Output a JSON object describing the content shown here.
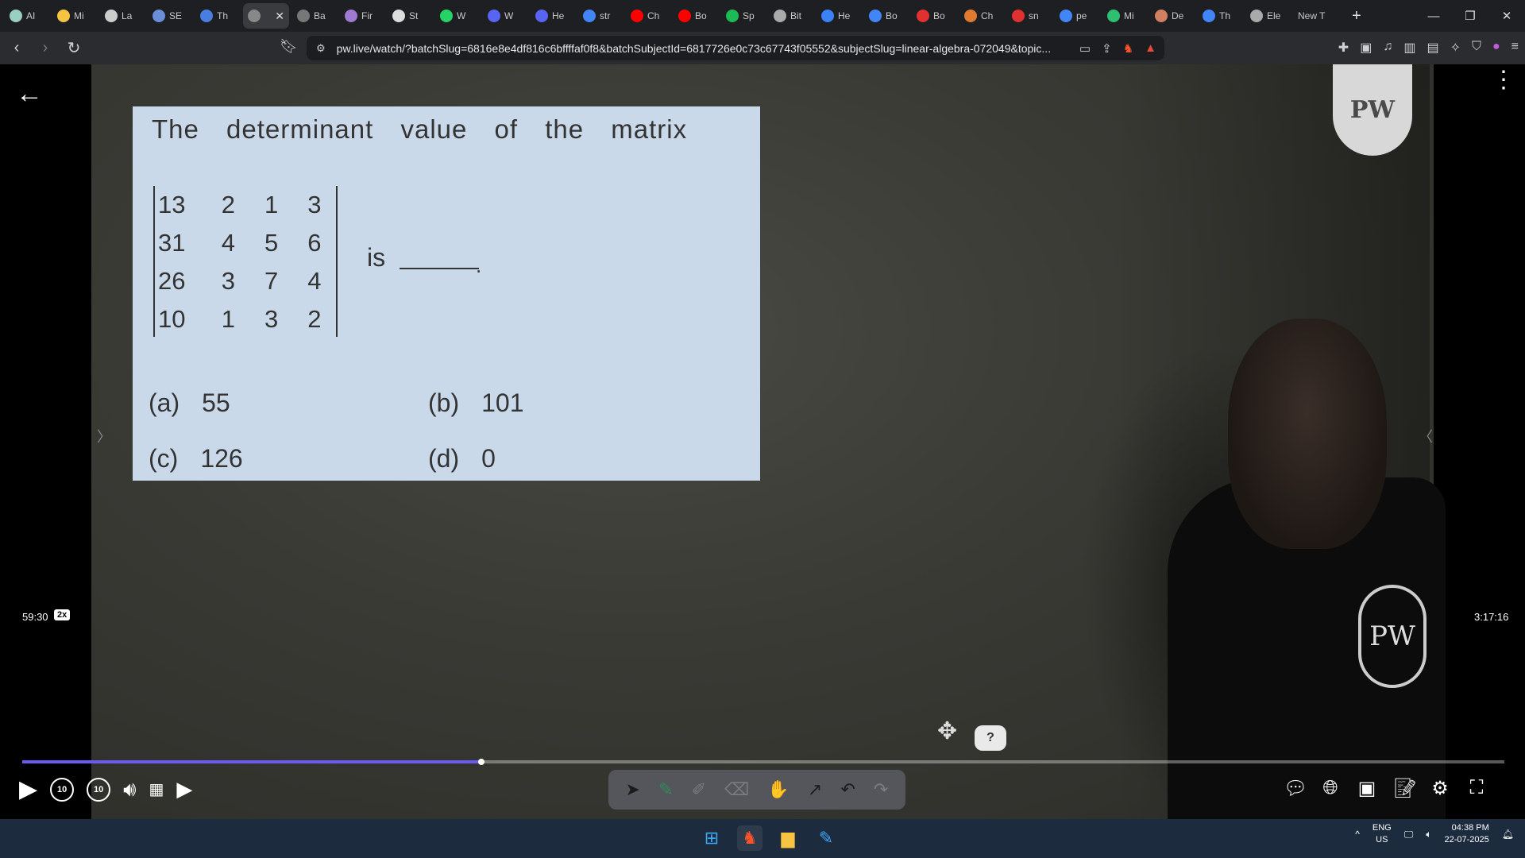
{
  "browser": {
    "tabs": [
      {
        "label": "AI",
        "icon": "chat-icon",
        "color": "#9ad0c2"
      },
      {
        "label": "Mi",
        "icon": "bolt-icon",
        "color": "#f5c542"
      },
      {
        "label": "La",
        "icon": "link-icon",
        "color": "#cccccc"
      },
      {
        "label": "SE",
        "icon": "grid-icon",
        "color": "#6a8fd8"
      },
      {
        "label": "Th",
        "icon": "w-icon",
        "color": "#4a7de0"
      },
      {
        "label": "",
        "icon": "pw-icon",
        "color": "#888888",
        "active": true
      },
      {
        "label": "Ba",
        "icon": "grid-icon",
        "color": "#777777"
      },
      {
        "label": "Fir",
        "icon": "fir-icon",
        "color": "#a07ad0"
      },
      {
        "label": "St",
        "icon": "gear-icon",
        "color": "#dddddd"
      },
      {
        "label": "W",
        "icon": "whatsapp-icon",
        "color": "#25d366"
      },
      {
        "label": "W",
        "icon": "globe-icon",
        "color": "#5865f2"
      },
      {
        "label": "He",
        "icon": "globe-icon",
        "color": "#5865f2"
      },
      {
        "label": "str",
        "icon": "google-icon",
        "color": "#4285f4"
      },
      {
        "label": "Ch",
        "icon": "youtube-icon",
        "color": "#ff0000"
      },
      {
        "label": "Bo",
        "icon": "youtube-icon",
        "color": "#ff0000"
      },
      {
        "label": "Sp",
        "icon": "spotify-icon",
        "color": "#1db954"
      },
      {
        "label": "Bit",
        "icon": "bit-icon",
        "color": "#aaaaaa"
      },
      {
        "label": "He",
        "icon": "f-icon",
        "color": "#3b82f6"
      },
      {
        "label": "Bo",
        "icon": "google-icon",
        "color": "#4285f4"
      },
      {
        "label": "Bo",
        "icon": "book-icon",
        "color": "#e03030"
      },
      {
        "label": "Ch",
        "icon": "flame-icon",
        "color": "#e07a30"
      },
      {
        "label": "sn",
        "icon": "d-icon",
        "color": "#e03030"
      },
      {
        "label": "pe",
        "icon": "google-icon",
        "color": "#4285f4"
      },
      {
        "label": "Mi",
        "icon": "circle-icon",
        "color": "#2fbf71"
      },
      {
        "label": "De",
        "icon": "gear-icon",
        "color": "#d08060"
      },
      {
        "label": "Th",
        "icon": "google-icon",
        "color": "#4285f4"
      },
      {
        "label": "Ele",
        "icon": "grid-icon",
        "color": "#aaaaaa"
      }
    ],
    "new_tab_label": "New T",
    "new_tab_plus": "+",
    "close_glyph": "✕",
    "url": "pw.live/watch/?batchSlug=6816e8e4df816c6bffffaf0f8&batchSubjectId=6817726e0c73c67743f05552&subjectSlug=linear-algebra-072049&topic..."
  },
  "question": {
    "title": "The determinant value of the matrix",
    "matrix": [
      [
        "13",
        "2",
        "1",
        "3"
      ],
      [
        "31",
        "4",
        "5",
        "6"
      ],
      [
        "26",
        "3",
        "7",
        "4"
      ],
      [
        "10",
        "1",
        "3",
        "2"
      ]
    ],
    "is_text": "is",
    "blank_dot": ".",
    "options": [
      {
        "label": "(a)",
        "value": "55"
      },
      {
        "label": "(b)",
        "value": "101"
      },
      {
        "label": "(c)",
        "value": "126"
      },
      {
        "label": "(d)",
        "value": "0"
      }
    ]
  },
  "player": {
    "current_time": "59:30",
    "speed": "2x",
    "total_time": "3:17:16",
    "progress_fraction": 0.31,
    "accent": "#6a5cf0",
    "help_label": "?",
    "skip_back_label": "10",
    "skip_fwd_label": "10",
    "logo_text": "PW",
    "shirt_logo_text": "PW"
  },
  "taskbar": {
    "lang_top": "ENG",
    "lang_bottom": "US",
    "time": "04:38 PM",
    "date": "22-07-2025"
  }
}
